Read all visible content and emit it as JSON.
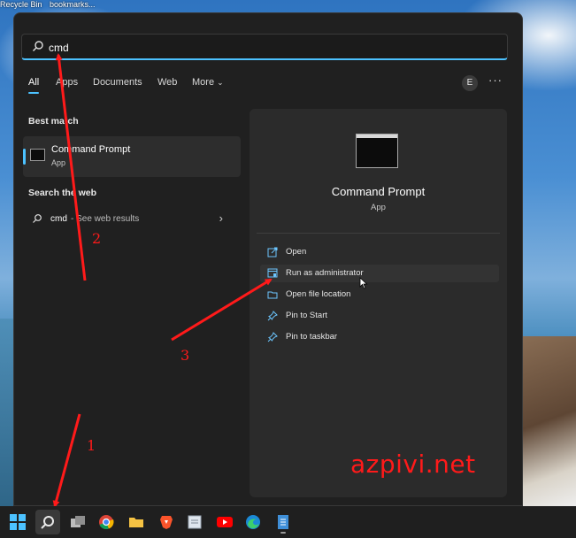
{
  "desktop": {
    "icons": [
      "Recycle Bin",
      "bookmarks..."
    ]
  },
  "search": {
    "query": "cmd"
  },
  "tabs": [
    "All",
    "Apps",
    "Documents",
    "Web",
    "More"
  ],
  "user_initial": "E",
  "best_match": {
    "heading": "Best match",
    "name": "Command Prompt",
    "type": "App"
  },
  "web": {
    "heading": "Search the web",
    "query": "cmd",
    "suffix": "- See web results"
  },
  "detail": {
    "name": "Command Prompt",
    "type": "App",
    "actions": [
      "Open",
      "Run as administrator",
      "Open file location",
      "Pin to Start",
      "Pin to taskbar"
    ]
  },
  "annotations": {
    "watermark": "azpivi.net",
    "steps": [
      "1",
      "2",
      "3"
    ],
    "color": "#ff1a1a"
  },
  "taskbar": {
    "icons": [
      "windows-start-icon",
      "search-icon",
      "task-view-icon",
      "chrome-icon",
      "file-explorer-icon",
      "brave-icon",
      "notepad-icon",
      "youtube-icon",
      "edge-icon",
      "notepad-blue-icon"
    ]
  },
  "colors": {
    "accent": "#4cc2ff",
    "menu_bg": "#202020",
    "panel_bg": "#2b2b2b"
  }
}
